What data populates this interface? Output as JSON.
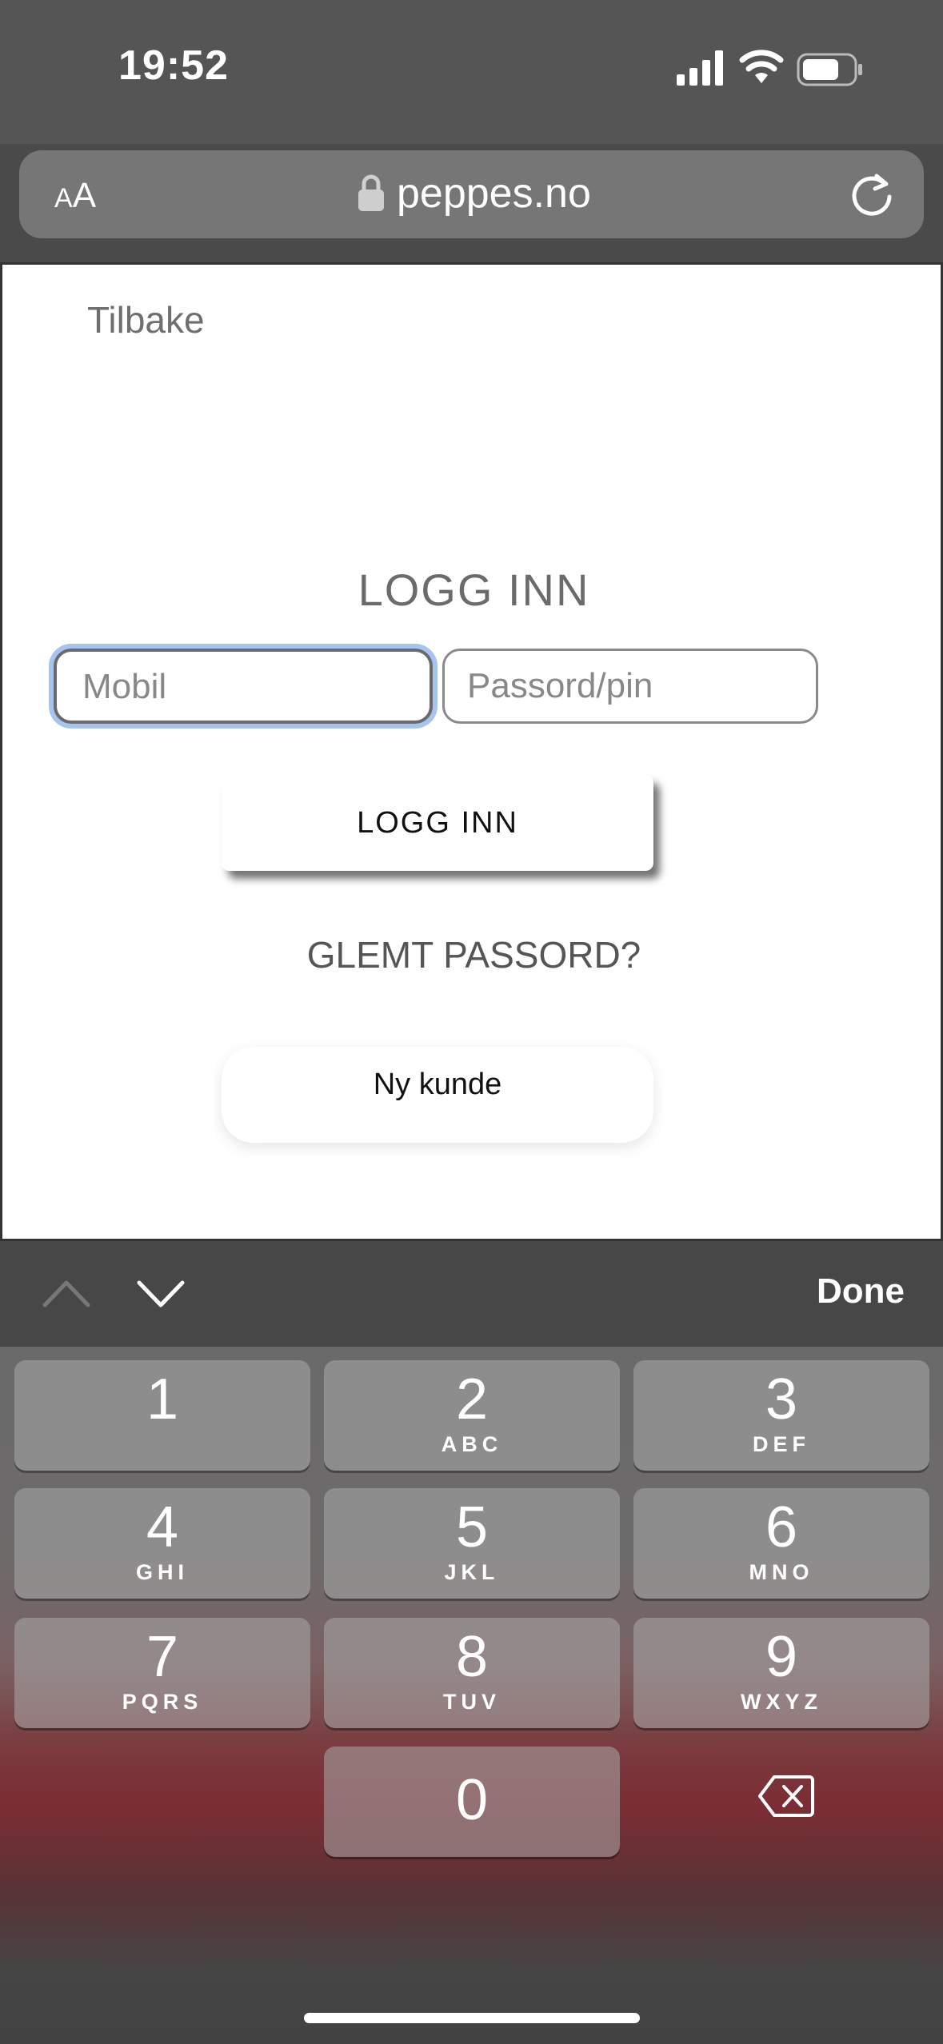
{
  "status_bar": {
    "time": "19:52"
  },
  "browser": {
    "aa_label_small": "A",
    "aa_label_large": "A",
    "url": "peppes.no"
  },
  "page": {
    "back_label": "Tilbake",
    "title": "LOGG INN",
    "mobile_placeholder": "Mobil",
    "password_placeholder": "Passord/pin",
    "login_button": "LOGG INN",
    "forgot_password": "GLEMT PASSORD?",
    "new_customer": "Ny kunde"
  },
  "keyboard_toolbar": {
    "done_label": "Done"
  },
  "keypad": {
    "keys": [
      {
        "digit": "1",
        "letters": ""
      },
      {
        "digit": "2",
        "letters": "ABC"
      },
      {
        "digit": "3",
        "letters": "DEF"
      },
      {
        "digit": "4",
        "letters": "GHI"
      },
      {
        "digit": "5",
        "letters": "JKL"
      },
      {
        "digit": "6",
        "letters": "MNO"
      },
      {
        "digit": "7",
        "letters": "PQRS"
      },
      {
        "digit": "8",
        "letters": "TUV"
      },
      {
        "digit": "9",
        "letters": "WXYZ"
      },
      {
        "digit": "0",
        "letters": ""
      }
    ]
  },
  "colors": {
    "focus_ring": "#a7c4ee",
    "keyboard_accent": "#7b2d33"
  },
  "icons": [
    "signal-icon",
    "wifi-icon",
    "battery-icon",
    "lock-icon",
    "reload-icon",
    "chevron-up-icon",
    "chevron-down-icon",
    "delete-icon"
  ]
}
